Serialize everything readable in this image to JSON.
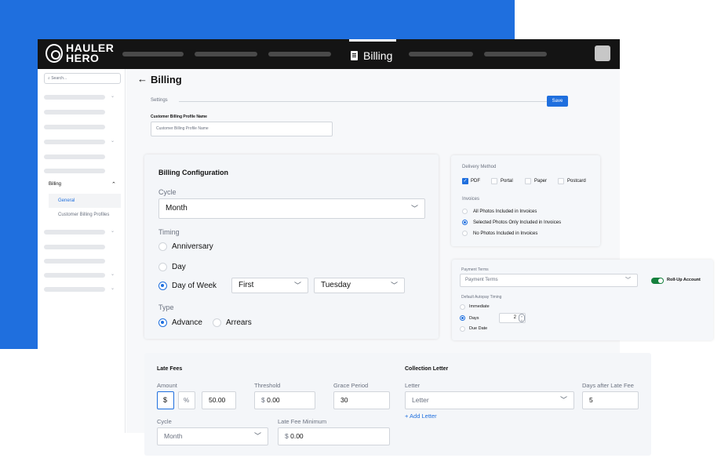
{
  "app": {
    "logo_line1": "HAULER",
    "logo_line2": "HERO",
    "active_tab": "Billing"
  },
  "sidebar": {
    "search_placeholder": "Search...",
    "billing_label": "Billing",
    "general_label": "General",
    "customer_billing_profiles_label": "Customer Billing Profiles"
  },
  "page": {
    "back_arrow": "←",
    "title": "Billing",
    "settings_label": "Settings",
    "save_label": "Save",
    "cbpn_label": "Customer Billing Profile Name",
    "cbpn_placeholder": "Customer Billing Profile Name"
  },
  "billing_config": {
    "title": "Billing Configuration",
    "cycle_label": "Cycle",
    "cycle_value": "Month",
    "timing_label": "Timing",
    "timing_options": [
      "Anniversary",
      "Day",
      "Day of Week"
    ],
    "timing_selected": "Day of Week",
    "week_value": "First",
    "weekday_value": "Tuesday",
    "type_label": "Type",
    "type_options": [
      "Advance",
      "Arrears"
    ],
    "type_selected": "Advance"
  },
  "delivery": {
    "title": "Delivery Method",
    "methods": [
      "PDF",
      "Portal",
      "Paper",
      "Postcard"
    ],
    "checked": [
      "PDF"
    ],
    "invoices_label": "Invoices",
    "invoice_options": [
      "All Photos Included in Invoices",
      "Selected Photos Only Included in Invoices",
      "No Photos Included in Invoices"
    ],
    "invoice_selected": "Selected Photos Only Included in Invoices"
  },
  "payment": {
    "terms_label": "Payment Terms",
    "terms_placeholder": "Payment Terms",
    "rollup_label": "Roll-Up Account",
    "autopay_label": "Default Autopay Timing",
    "autopay_options": [
      "Immediate",
      "Days",
      "Due Date"
    ],
    "autopay_selected": "Days",
    "days_value": "2"
  },
  "late_fees": {
    "title": "Late Fees",
    "amount_label": "Amount",
    "dollar": "$",
    "percent": "%",
    "amount_value": "50.00",
    "threshold_label": "Threshold",
    "threshold_value": "0.00",
    "grace_label": "Grace Period",
    "grace_value": "30",
    "cycle_label": "Cycle",
    "cycle_value": "Month",
    "min_label": "Late Fee Minimum",
    "min_value": "0.00"
  },
  "collection": {
    "title": "Collection Letter",
    "letter_label": "Letter",
    "letter_placeholder": "Letter",
    "days_label": "Days after Late Fee",
    "days_value": "5",
    "add_label": "+ Add Letter"
  },
  "colors": {
    "accent": "#1f6fde",
    "topbar": "#141414",
    "toggle_on": "#15803d"
  }
}
